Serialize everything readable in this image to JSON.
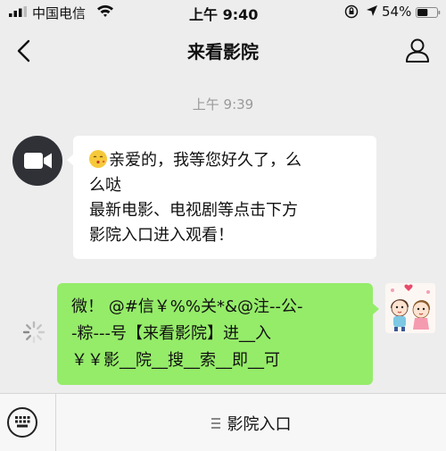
{
  "status_bar": {
    "carrier": "中国电信",
    "time": "上午 9:40",
    "battery_percent": "54%",
    "battery_level": 0.54
  },
  "nav": {
    "title": "来看影院",
    "back_icon": "chevron-left-icon",
    "profile_icon": "person-icon"
  },
  "chat": {
    "timestamp": "上午 9:39",
    "incoming": {
      "line1": "亲爱的，我等您好久了，么",
      "line2": "么哒",
      "line3": "最新电影、电视剧等点击下方",
      "line4": "影院入口进入观看！"
    },
    "outgoing": {
      "line1": "微！ @#信￥%%关*&@注--公-",
      "line2": "-粽---号【来看影院】进__入",
      "line3": "￥￥影__院__搜__索__即__可"
    }
  },
  "bottom_bar": {
    "menu_label": "影院入口",
    "keyboard_icon": "keyboard-icon"
  },
  "colors": {
    "background": "#ededed",
    "outgoing_bubble": "#95ec69",
    "incoming_bubble": "#ffffff"
  }
}
